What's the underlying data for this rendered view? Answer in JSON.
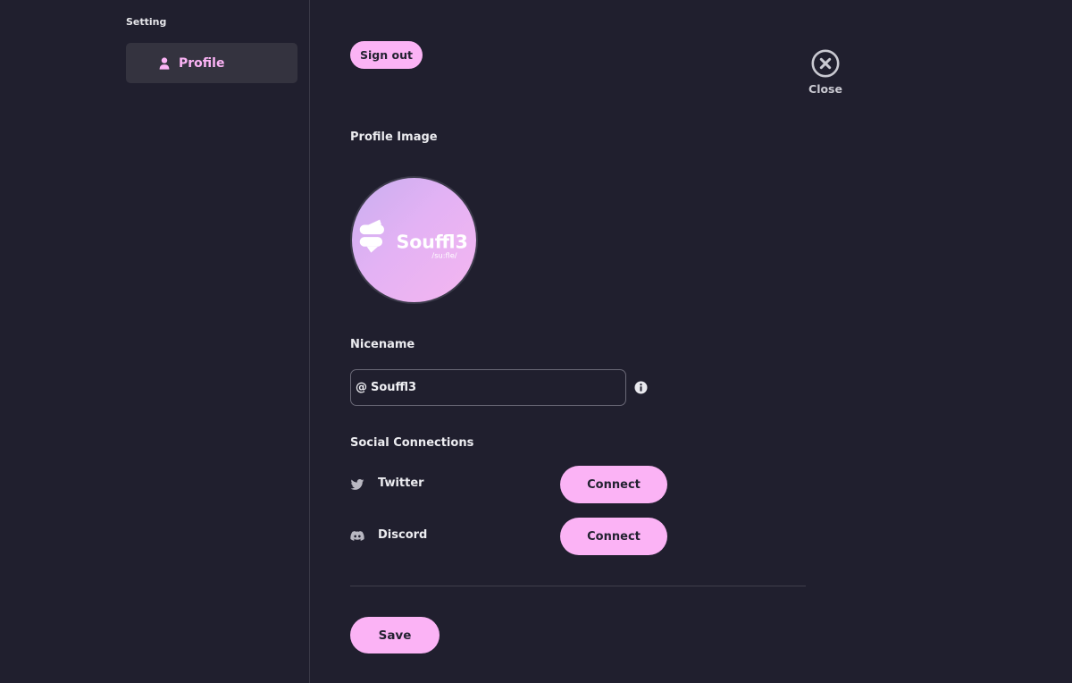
{
  "theme": {
    "accent": "#fbb3f5",
    "background": "#201f2e",
    "sidebar_active_bg": "#34333f"
  },
  "sidebar": {
    "heading": "Setting",
    "items": [
      {
        "label": "Profile",
        "icon": "user-icon",
        "active": true
      }
    ]
  },
  "header": {
    "sign_out_label": "Sign out",
    "close_label": "Close",
    "close_icon": "close-circle-icon"
  },
  "profile_image": {
    "label": "Profile Image",
    "logo_text": "Souffl3",
    "logo_subtext": "/su:fle/"
  },
  "nicename": {
    "label": "Nicename",
    "prefix": "@",
    "value": "Souffl3",
    "info_icon": "info-icon"
  },
  "social": {
    "label": "Social Connections",
    "items": [
      {
        "name": "Twitter",
        "icon": "twitter-icon",
        "button_label": "Connect"
      },
      {
        "name": "Discord",
        "icon": "discord-icon",
        "button_label": "Connect"
      }
    ]
  },
  "footer": {
    "save_label": "Save"
  }
}
